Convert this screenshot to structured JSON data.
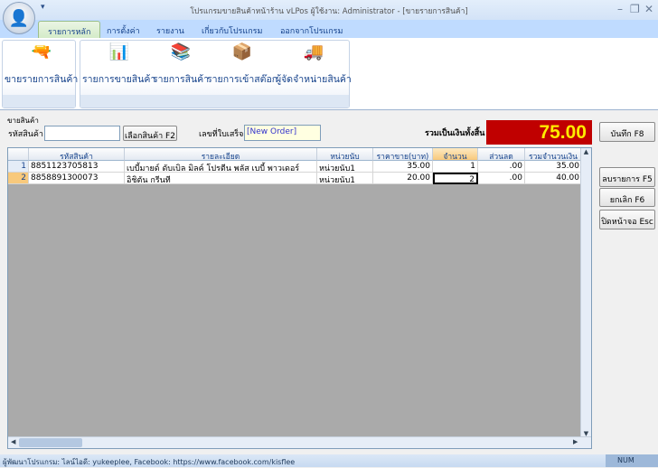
{
  "window": {
    "title": "โปรแกรมขายสินค้าหน้าร้าน vLPos ผู้ใช้งาน: Administrator - [ขายรายการสินค้า]"
  },
  "tabs": [
    "รายการหลัก",
    "การตั้งค่า",
    "รายงาน",
    "เกี่ยวกับโปรแกรม",
    "ออกจากโปรแกรม"
  ],
  "ribbon": {
    "sell": "ขายรายการสินค้า",
    "sales_list": "รายการขายสินค้า",
    "products": "รายการสินค้า",
    "stock_in": "รายการเข้าสต๊อก",
    "suppliers": "ผู้จัดจำหน่ายสินค้า"
  },
  "form": {
    "group_label": "ขายสินค้า",
    "code_label": "รหัสสินค้า",
    "code_value": "",
    "select_button": "เลือกสินค้า F2",
    "receipt_label": "เลขที่ใบเสร็จ",
    "receipt_value": "[New Order]",
    "total_label": "รวมเป็นเงินทั้งสิ้น",
    "total_value": "75.00"
  },
  "buttons": {
    "save": "บันทึก F8",
    "delete": "ลบรายการ F5",
    "cancel": "ยกเลิก F6",
    "close": "ปิดหน้าจอ Esc"
  },
  "grid": {
    "headers": [
      "รหัสสินค้า",
      "รายละเอียด",
      "หน่วยนับ",
      "ราคาขาย(บาท)",
      "จำนวน",
      "ส่วนลด",
      "รวมจำนวนเงิน"
    ],
    "rows": [
      {
        "n": "1",
        "code": "8851123705813",
        "desc": "เบบี้มายด์ ดับเบิล มิลค์ โปรตีน พลัส เบบี้ พาวเดอร์",
        "unit": "หน่วยนับ1",
        "price": "35.00",
        "qty": "1",
        "discount": ".00",
        "total": "35.00"
      },
      {
        "n": "2",
        "code": "8858891300073",
        "desc": "อิชิตัน กรีนที",
        "unit": "หน่วยนับ1",
        "price": "20.00",
        "qty": "2",
        "discount": ".00",
        "total": "40.00"
      }
    ]
  },
  "status": {
    "text": "ผู้พัฒนาโปรแกรม: ไลน์ไอดี: yukeeplee, Facebook: https://www.facebook.com/kisflee",
    "num": "NUM"
  }
}
